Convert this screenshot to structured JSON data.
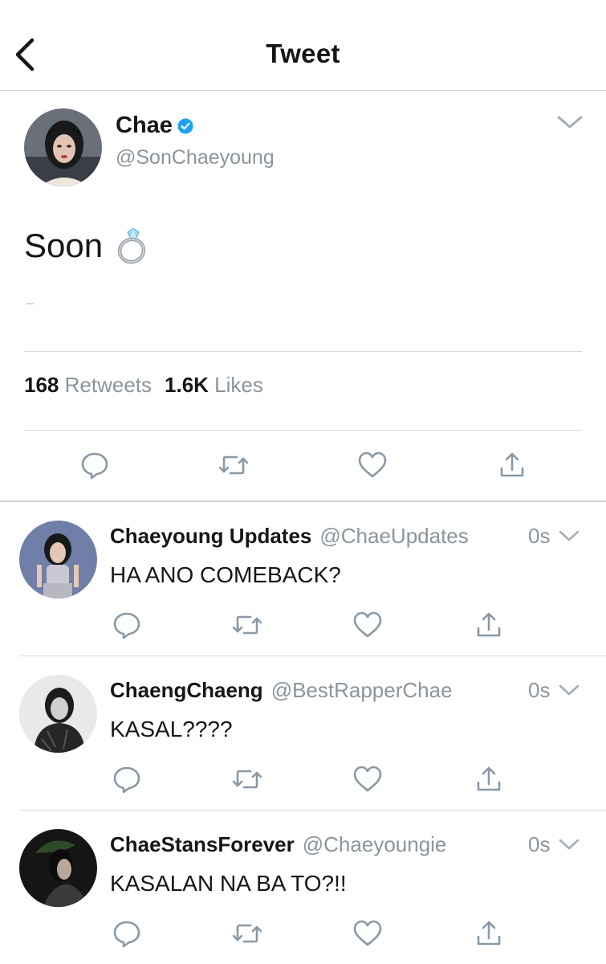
{
  "header": {
    "title": "Tweet"
  },
  "tweet": {
    "author_name": "Chae",
    "author_handle": "@SonChaeyoung",
    "verified": true,
    "text": "Soon",
    "emoji": "ring",
    "retweets_count": "168",
    "retweets_label": "Retweets",
    "likes_count": "1.6K",
    "likes_label": "Likes"
  },
  "replies": [
    {
      "name": "Chaeyoung Updates",
      "handle": "@ChaeUpdates",
      "time": "0s",
      "text": "HA ANO COMEBACK?"
    },
    {
      "name": "ChaengChaeng",
      "handle": "@BestRapperChae",
      "time": "0s",
      "text": "KASAL????"
    },
    {
      "name": "ChaeStansForever",
      "handle": "@Chaeyoungie",
      "time": "0s",
      "text": "KASALAN NA BA TO?!!"
    }
  ],
  "colors": {
    "text": "#14171a",
    "secondary": "#8b959e",
    "verified": "#1da1f2",
    "icon": "#8899a6"
  }
}
